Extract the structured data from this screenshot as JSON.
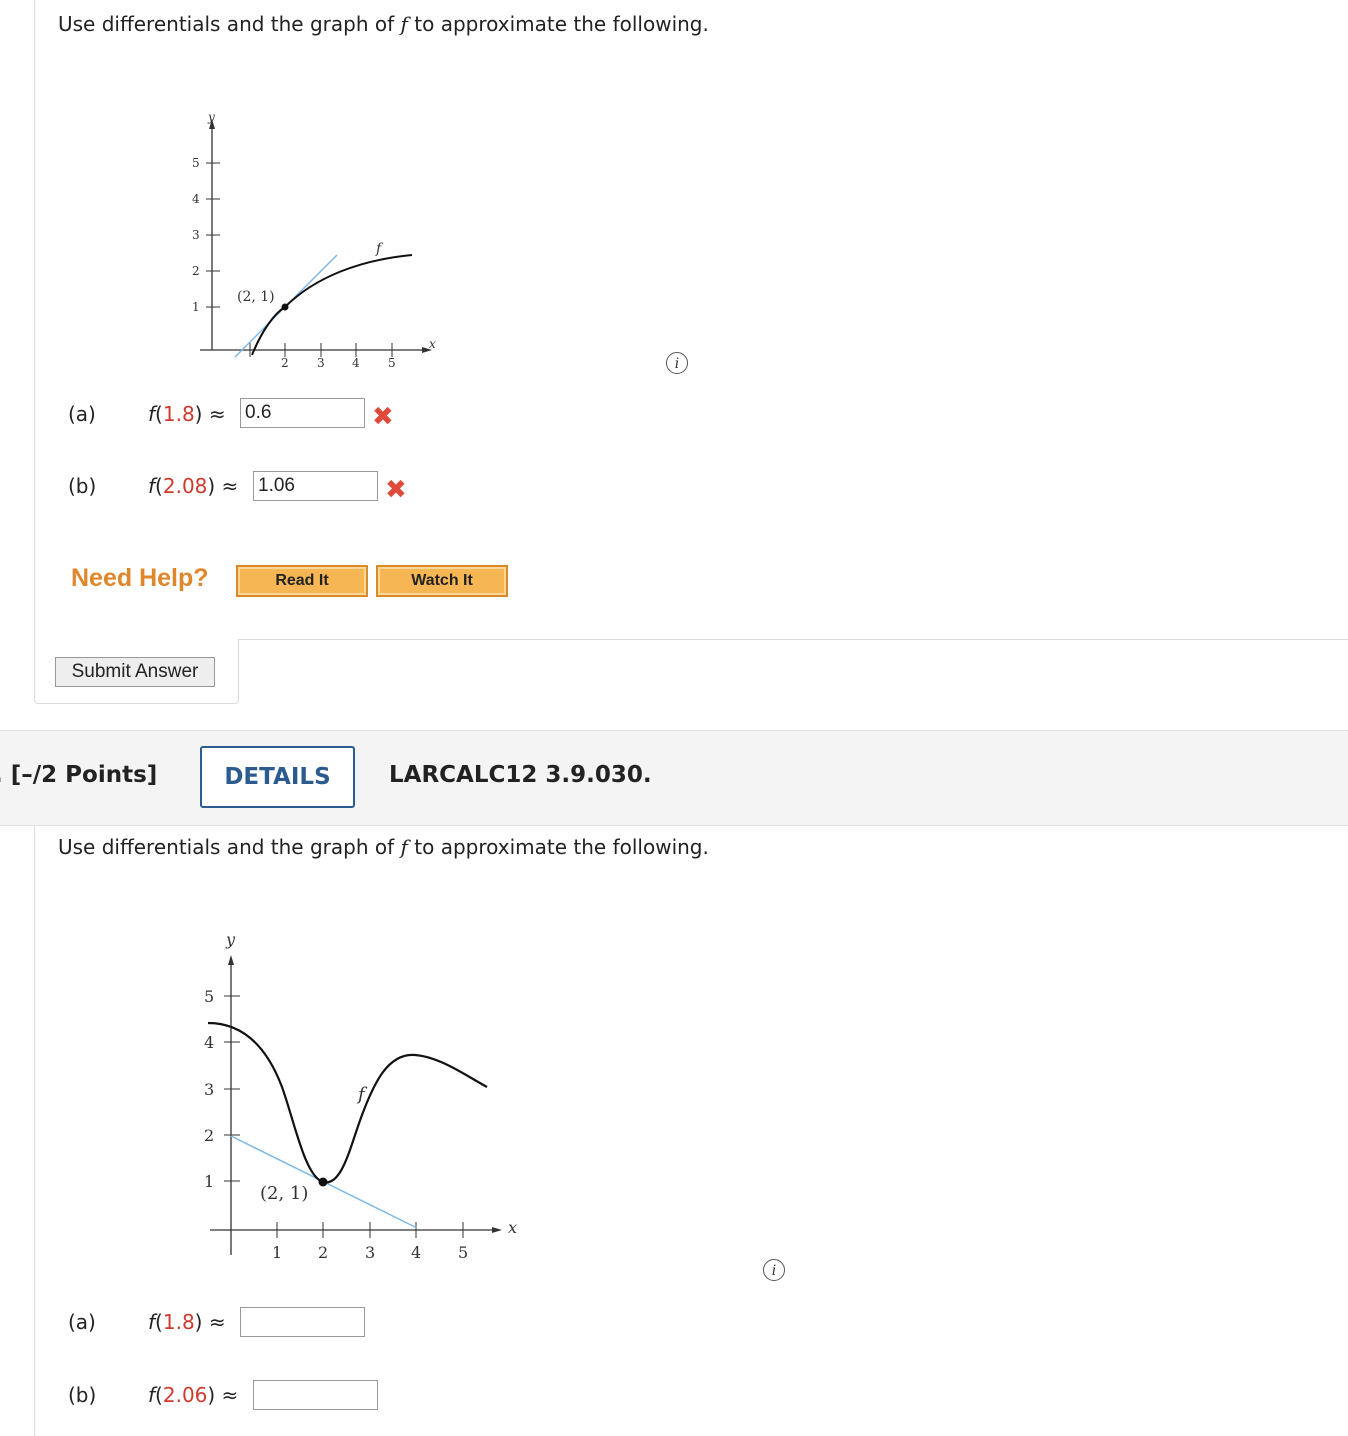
{
  "q1": {
    "prompt_pre": "Use differentials and the graph of ",
    "prompt_fn": "f",
    "prompt_post": " to approximate the following.",
    "graph": {
      "y_label": "y",
      "x_label": "x",
      "curve_label": "f",
      "point_label": "(2, 1)",
      "y_ticks": [
        "5",
        "4",
        "3",
        "2",
        "1"
      ],
      "x_ticks": [
        "2",
        "3",
        "4",
        "5"
      ]
    },
    "info_icon": "i",
    "parts": [
      {
        "label": "(a)",
        "fn": "f",
        "open": "(",
        "arg": "1.8",
        "close": ")",
        "approx": " ≈",
        "value": "0.6",
        "status": "✖"
      },
      {
        "label": "(b)",
        "fn": "f",
        "open": "(",
        "arg": "2.08",
        "close": ")",
        "approx": " ≈",
        "value": "1.06",
        "status": "✖"
      }
    ],
    "need_help": "Need Help?",
    "read_it": "Read It",
    "watch_it": "Watch It",
    "submit": "Submit Answer"
  },
  "q2": {
    "points": ". [–/2 Points]",
    "details": "DETAILS",
    "id": "LARCALC12 3.9.030.",
    "prompt_pre": "Use differentials and the graph of ",
    "prompt_fn": "f",
    "prompt_post": " to approximate the following.",
    "graph": {
      "y_label": "y",
      "x_label": "x",
      "curve_label": "f",
      "point_label": "(2, 1)",
      "y_ticks": [
        "5",
        "4",
        "3",
        "2",
        "1"
      ],
      "x_ticks": [
        "1",
        "2",
        "3",
        "4",
        "5"
      ]
    },
    "info_icon": "i",
    "parts": [
      {
        "label": "(a)",
        "fn": "f",
        "open": "(",
        "arg": "1.8",
        "close": ")",
        "approx": " ≈",
        "value": ""
      },
      {
        "label": "(b)",
        "fn": "f",
        "open": "(",
        "arg": "2.06",
        "close": ")",
        "approx": " ≈",
        "value": ""
      }
    ]
  },
  "colors": {
    "accent": "#2c5c8f",
    "error": "#e04a3a",
    "help": "#e0872c",
    "tangent": "#7db9e8"
  }
}
